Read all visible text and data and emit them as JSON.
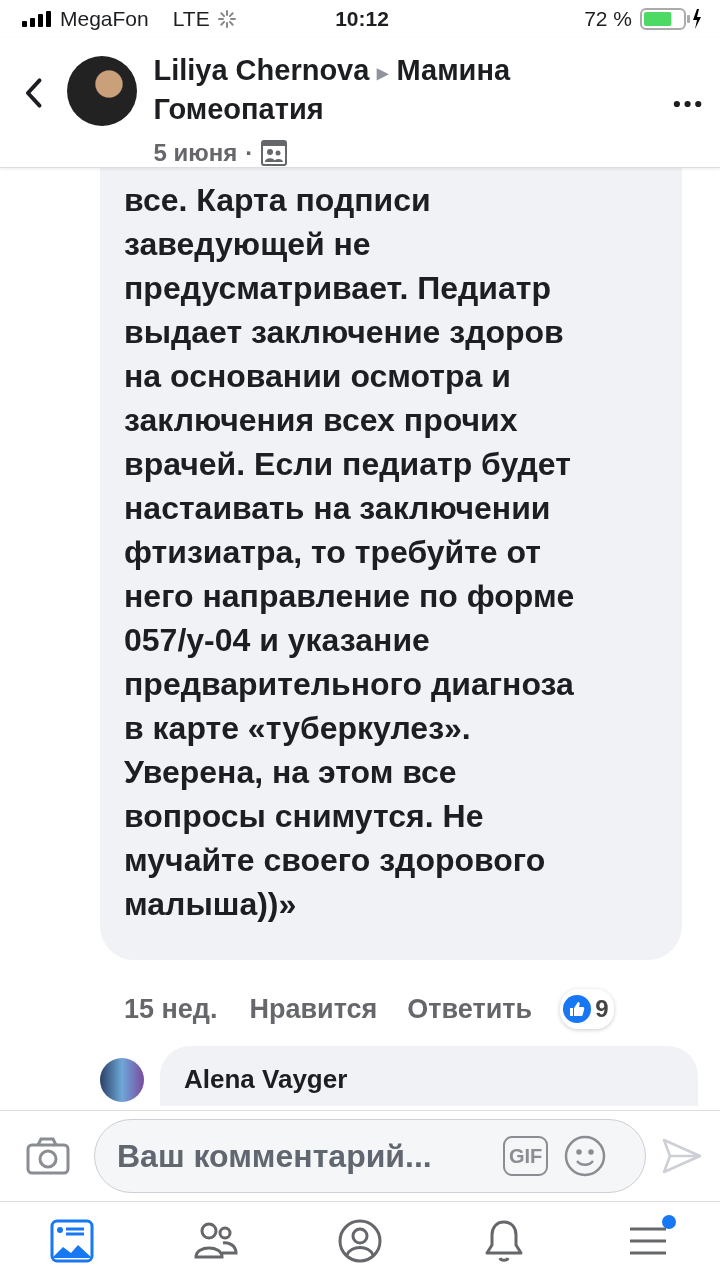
{
  "status_bar": {
    "carrier": "MegaFon",
    "network": "LTE",
    "time": "10:12",
    "battery_text": "72 %",
    "battery": {
      "level": 0.72
    }
  },
  "header": {
    "author": "Liliya Chernova",
    "separator": "▸",
    "group": "Мамина Гомеопатия",
    "date": "5 июня",
    "dot": "·"
  },
  "comment": {
    "lines": [
      "все. Карта подписи",
      "заведующей не",
      "предусматривает. Педиатр",
      "выдает заключение здоров",
      "на основании осмотра и",
      "заключения всех прочих",
      "врачей. Если педиатр будет",
      "настаивать на заключении",
      "фтизиатра, то требуйте от",
      "него направление по форме",
      "057/у-04 и указание",
      "предварительного диагноза",
      "в карте «туберкулез».",
      "Уверена, на этом все",
      "вопросы снимутся. Не",
      "мучайте своего здорового",
      "малыша))»"
    ],
    "time": "15 нед.",
    "like": "Нравится",
    "reply": "Ответить",
    "reaction_count": "9"
  },
  "next_comment": {
    "author": "Alena Vayger"
  },
  "composer": {
    "placeholder": "Ваш комментарий...",
    "gif": "GIF"
  },
  "tabs": [
    {
      "kind": "feed",
      "selected": true
    },
    {
      "kind": "friends",
      "selected": false
    },
    {
      "kind": "profile",
      "selected": false
    },
    {
      "kind": "notifications",
      "selected": false
    },
    {
      "kind": "menu",
      "selected": false,
      "badge": true
    }
  ]
}
